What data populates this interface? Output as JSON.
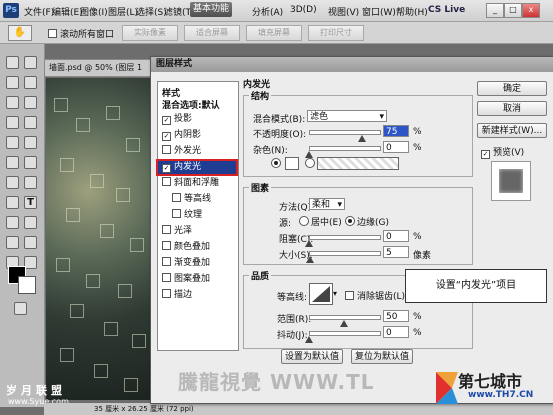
{
  "menubar": {
    "ps_icon": "Ps",
    "items": [
      "文件(F)",
      "编辑(E)",
      "图像(I)",
      "图层(L)",
      "选择(S)",
      "滤镜(T)",
      "分析(A)",
      "3D(D)",
      "视图(V)",
      "窗口(W)",
      "帮助(H)"
    ],
    "basic_function": "基本功能",
    "cs_live": "CS Live",
    "win_minimize": "_",
    "win_restore": "□",
    "win_close": "x"
  },
  "optionsbar": {
    "auto_select_label": "滚动所有窗口",
    "buttons": [
      "实际像素",
      "适合屏幕",
      "填充屏幕",
      "打印尺寸"
    ]
  },
  "document": {
    "tab_title": "墙面.psd @ 50% (图层 1",
    "status_text": "35 厘米 x 26.25 厘米 (72 ppi)"
  },
  "watermarks": {
    "left_brand": "岁月联盟",
    "left_url": "www.Syue.com",
    "center": "騰龍視覺 WWW.TL"
  },
  "logo": {
    "name": "第七城市",
    "url": "www.TH7.CN"
  },
  "dialog": {
    "title": "图层样式",
    "styles_header": "样式",
    "blend_default": "混合选项:默认",
    "styles": [
      {
        "label": "投影",
        "checked": true,
        "indent": false
      },
      {
        "label": "内阴影",
        "checked": true,
        "indent": false
      },
      {
        "label": "外发光",
        "checked": false,
        "indent": false
      },
      {
        "label": "内发光",
        "checked": true,
        "indent": false,
        "selected": true
      },
      {
        "label": "斜面和浮雕",
        "checked": false,
        "indent": false
      },
      {
        "label": "等高线",
        "checked": false,
        "indent": true
      },
      {
        "label": "纹理",
        "checked": false,
        "indent": true
      },
      {
        "label": "光泽",
        "checked": false,
        "indent": false
      },
      {
        "label": "颜色叠加",
        "checked": false,
        "indent": false
      },
      {
        "label": "渐变叠加",
        "checked": false,
        "indent": false
      },
      {
        "label": "图案叠加",
        "checked": false,
        "indent": false
      },
      {
        "label": "描边",
        "checked": false,
        "indent": false
      }
    ],
    "section_title": "内发光",
    "structure": {
      "title": "结构",
      "blend_mode_label": "混合模式(B):",
      "blend_mode_value": "滤色",
      "opacity_label": "不透明度(O):",
      "opacity_value": "75",
      "opacity_unit": "%",
      "opacity_fraction": 0.75,
      "noise_label": "杂色(N):",
      "noise_value": "0",
      "noise_unit": "%",
      "noise_fraction": 0
    },
    "elements": {
      "title": "图素",
      "method_label": "方法(Q):",
      "method_value": "柔和",
      "source_label": "源:",
      "source_center": "居中(E)",
      "source_edge": "边缘(G)",
      "choke_label": "阻塞(C):",
      "choke_value": "0",
      "choke_unit": "%",
      "choke_fraction": 0,
      "size_label": "大小(S):",
      "size_value": "5",
      "size_unit": "像素",
      "size_fraction": 0.02
    },
    "quality": {
      "title": "品质",
      "contour_label": "等高线:",
      "antialias_label": "消除锯齿(L)",
      "range_label": "范围(R):",
      "range_value": "50",
      "range_unit": "%",
      "range_fraction": 0.5,
      "jitter_label": "抖动(J):",
      "jitter_value": "0",
      "jitter_unit": "%",
      "jitter_fraction": 0
    },
    "set_default": "设置为默认值",
    "reset_default": "复位为默认值",
    "ok": "确定",
    "cancel": "取消",
    "new_style": "新建样式(W)...",
    "preview_label": "预览(V)"
  },
  "callout": "设置“内发光”项目"
}
